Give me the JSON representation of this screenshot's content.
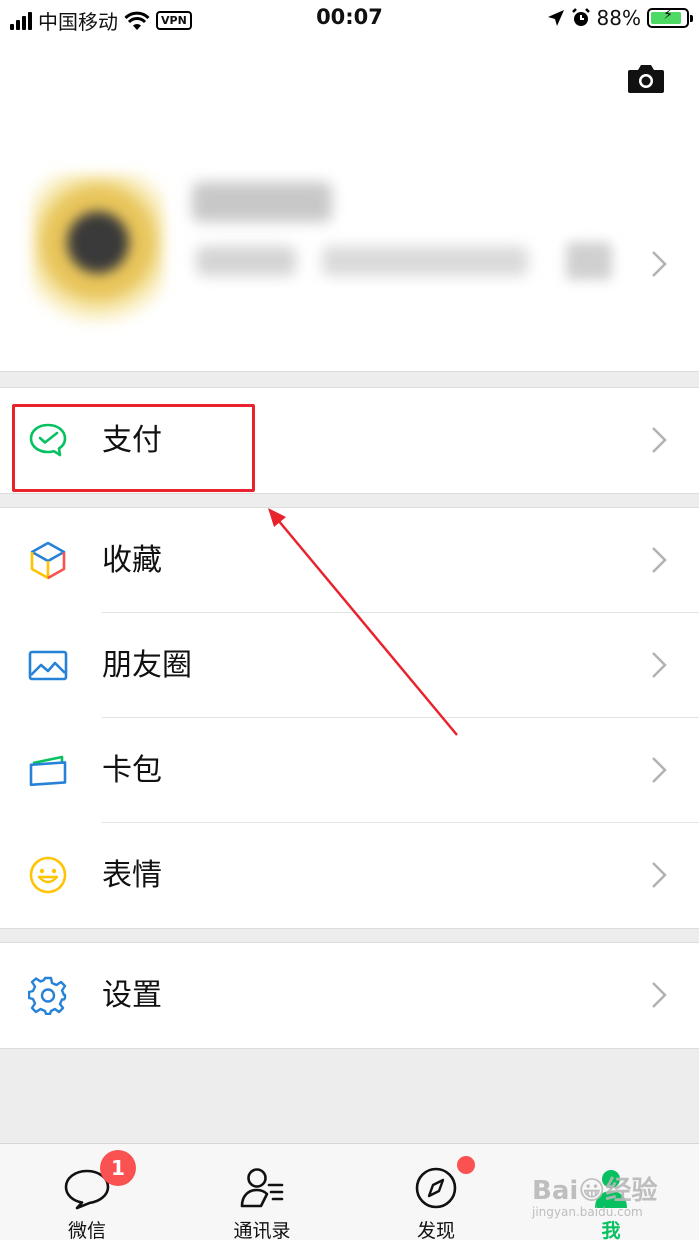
{
  "status_bar": {
    "carrier": "中国移动",
    "vpn": "VPN",
    "time": "00:07",
    "battery": "88%",
    "battery_level": 0.88
  },
  "profile": {
    "camera_icon": "camera-icon",
    "chevron_icon": "chevron-right-icon"
  },
  "menu": {
    "pay": {
      "label": "支付",
      "icon": "wechat-pay-icon",
      "color": "#07c160"
    },
    "favorites": {
      "label": "收藏",
      "icon": "cube-icon"
    },
    "moments": {
      "label": "朋友圈",
      "icon": "image-icon",
      "color": "#2782d7"
    },
    "cards": {
      "label": "卡包",
      "icon": "card-wallet-icon"
    },
    "stickers": {
      "label": "表情",
      "icon": "smiley-icon",
      "color": "#ffc300"
    },
    "settings": {
      "label": "设置",
      "icon": "gear-icon",
      "color": "#2782d7"
    }
  },
  "tabs": [
    {
      "label": "微信",
      "icon": "chat-bubble-icon",
      "badge": "1"
    },
    {
      "label": "通讯录",
      "icon": "contacts-icon"
    },
    {
      "label": "发现",
      "icon": "compass-icon"
    },
    {
      "label": "我",
      "icon": "person-icon",
      "active": true
    }
  ],
  "watermark": {
    "line1": "Bai😀经验",
    "line2": "jingyan.baidu.com"
  },
  "colors": {
    "accent": "#07c160",
    "badge": "#fa5151",
    "annotation": "#e8232e"
  }
}
